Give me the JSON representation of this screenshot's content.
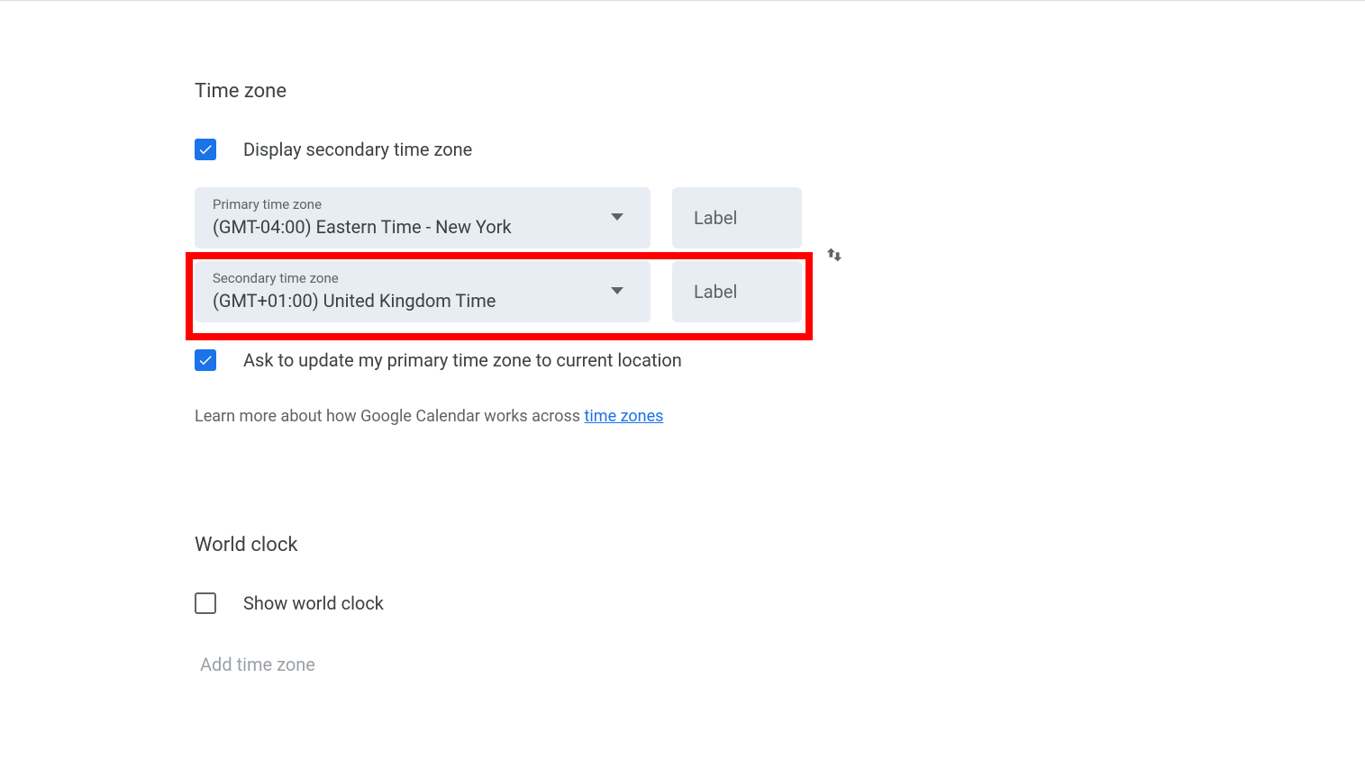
{
  "timezone": {
    "title": "Time zone",
    "display_secondary_label": "Display secondary time zone",
    "primary": {
      "label": "Primary time zone",
      "value": "(GMT-04:00) Eastern Time - New York",
      "field_placeholder": "Label"
    },
    "secondary": {
      "label": "Secondary time zone",
      "value": "(GMT+01:00) United Kingdom Time",
      "field_placeholder": "Label"
    },
    "ask_update_label": "Ask to update my primary time zone to current location",
    "help_prefix": "Learn more about how Google Calendar works across ",
    "help_link": "time zones"
  },
  "worldclock": {
    "title": "World clock",
    "show_label": "Show world clock",
    "add_label": "Add time zone"
  }
}
